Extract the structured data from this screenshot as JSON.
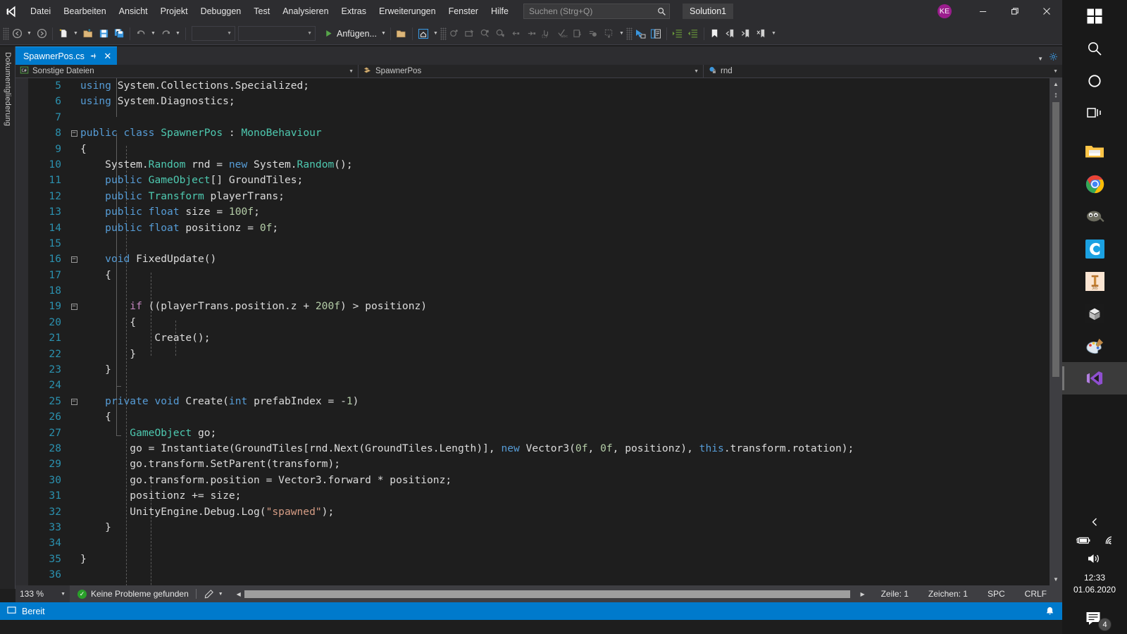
{
  "app": {
    "title": "Visual Studio",
    "solution": "Solution1",
    "user_initials": "KE"
  },
  "menu": {
    "items": [
      "Datei",
      "Bearbeiten",
      "Ansicht",
      "Projekt",
      "Debuggen",
      "Test",
      "Analysieren",
      "Extras",
      "Erweiterungen",
      "Fenster",
      "Hilfe"
    ]
  },
  "search": {
    "placeholder": "Suchen (Strg+Q)",
    "value": "",
    "icon": "search-icon"
  },
  "window_controls": {
    "minimize": "—",
    "restore": "❐",
    "close": "✕"
  },
  "toolbar": {
    "navigate_back": "navigate-back-icon",
    "navigate_forward": "navigate-forward-icon",
    "new_item": "new-item-icon",
    "open_file": "open-file-icon",
    "save": "save-icon",
    "save_all": "save-all-icon",
    "undo": "undo-icon",
    "redo": "redo-icon",
    "config_combo": "",
    "platform_combo": "",
    "run_label": "Anfügen...",
    "run_icon": "play-icon"
  },
  "outline_panel": {
    "label": "Dokumentgliederung"
  },
  "tab": {
    "filename": "SpawnerPos.cs",
    "pin_icon": "pin-icon",
    "close_icon": "close-icon"
  },
  "navbar": {
    "project": "Sonstige Dateien",
    "project_icon": "csharp-file-icon",
    "type": "SpawnerPos",
    "type_icon": "class-icon",
    "member": "rnd",
    "member_icon": "field-private-icon"
  },
  "editor": {
    "first_line": 5,
    "lines": [
      {
        "n": 5,
        "fold": "",
        "tokens": [
          [
            "kw",
            "using"
          ],
          [
            "id",
            " System.Collections.Specialized;"
          ]
        ],
        "indent": 0
      },
      {
        "n": 6,
        "fold": "",
        "tokens": [
          [
            "kw",
            "using"
          ],
          [
            "id",
            " System.Diagnostics;"
          ]
        ],
        "indent": 0
      },
      {
        "n": 7,
        "fold": "",
        "tokens": [],
        "indent": 0
      },
      {
        "n": 8,
        "fold": "-",
        "tokens": [
          [
            "kw",
            "public"
          ],
          [
            "id",
            " "
          ],
          [
            "kw",
            "class"
          ],
          [
            "id",
            " "
          ],
          [
            "typ",
            "SpawnerPos"
          ],
          [
            "id",
            " : "
          ],
          [
            "typ",
            "MonoBehaviour"
          ]
        ],
        "indent": 0
      },
      {
        "n": 9,
        "fold": "",
        "tokens": [
          [
            "id",
            "{"
          ]
        ],
        "indent": 0
      },
      {
        "n": 10,
        "fold": "",
        "tokens": [
          [
            "id",
            "    System."
          ],
          [
            "typ",
            "Random"
          ],
          [
            "id",
            " rnd = "
          ],
          [
            "kw",
            "new"
          ],
          [
            "id",
            " System."
          ],
          [
            "typ",
            "Random"
          ],
          [
            "id",
            "();"
          ]
        ],
        "indent": 0
      },
      {
        "n": 11,
        "fold": "",
        "tokens": [
          [
            "id",
            "    "
          ],
          [
            "kw",
            "public"
          ],
          [
            "id",
            " "
          ],
          [
            "typ",
            "GameObject"
          ],
          [
            "id",
            "[] GroundTiles;"
          ]
        ],
        "indent": 0
      },
      {
        "n": 12,
        "fold": "",
        "tokens": [
          [
            "id",
            "    "
          ],
          [
            "kw",
            "public"
          ],
          [
            "id",
            " "
          ],
          [
            "typ",
            "Transform"
          ],
          [
            "id",
            " playerTrans;"
          ]
        ],
        "indent": 0
      },
      {
        "n": 13,
        "fold": "",
        "tokens": [
          [
            "id",
            "    "
          ],
          [
            "kw",
            "public"
          ],
          [
            "id",
            " "
          ],
          [
            "kw",
            "float"
          ],
          [
            "id",
            " size = "
          ],
          [
            "num",
            "100f"
          ],
          [
            "id",
            ";"
          ]
        ],
        "indent": 0
      },
      {
        "n": 14,
        "fold": "",
        "tokens": [
          [
            "id",
            "    "
          ],
          [
            "kw",
            "public"
          ],
          [
            "id",
            " "
          ],
          [
            "kw",
            "float"
          ],
          [
            "id",
            " positionz = "
          ],
          [
            "num",
            "0f"
          ],
          [
            "id",
            ";"
          ]
        ],
        "indent": 0
      },
      {
        "n": 15,
        "fold": "",
        "tokens": [],
        "indent": 0
      },
      {
        "n": 16,
        "fold": "-",
        "tokens": [
          [
            "id",
            "    "
          ],
          [
            "kw",
            "void"
          ],
          [
            "id",
            " FixedUpdate()"
          ]
        ],
        "indent": 0
      },
      {
        "n": 17,
        "fold": "",
        "tokens": [
          [
            "id",
            "    {"
          ]
        ],
        "indent": 0
      },
      {
        "n": 18,
        "fold": "",
        "tokens": [],
        "indent": 0
      },
      {
        "n": 19,
        "fold": "-",
        "tokens": [
          [
            "id",
            "        "
          ],
          [
            "kwp",
            "if"
          ],
          [
            "id",
            " ((playerTrans.position.z + "
          ],
          [
            "num",
            "200f"
          ],
          [
            "id",
            ") > positionz)"
          ]
        ],
        "indent": 0
      },
      {
        "n": 20,
        "fold": "",
        "tokens": [
          [
            "id",
            "        {"
          ]
        ],
        "indent": 0
      },
      {
        "n": 21,
        "fold": "",
        "tokens": [
          [
            "id",
            "            Create();"
          ]
        ],
        "indent": 0
      },
      {
        "n": 22,
        "fold": "",
        "tokens": [
          [
            "id",
            "        }"
          ]
        ],
        "indent": 0
      },
      {
        "n": 23,
        "fold": "",
        "tokens": [
          [
            "id",
            "    }"
          ]
        ],
        "indent": 0
      },
      {
        "n": 24,
        "fold": "",
        "tokens": [],
        "indent": 0
      },
      {
        "n": 25,
        "fold": "-",
        "tokens": [
          [
            "id",
            "    "
          ],
          [
            "kw",
            "private"
          ],
          [
            "id",
            " "
          ],
          [
            "kw",
            "void"
          ],
          [
            "id",
            " Create("
          ],
          [
            "kw",
            "int"
          ],
          [
            "id",
            " prefabIndex = -"
          ],
          [
            "num",
            "1"
          ],
          [
            "id",
            ")"
          ]
        ],
        "indent": 0
      },
      {
        "n": 26,
        "fold": "",
        "tokens": [
          [
            "id",
            "    {"
          ]
        ],
        "indent": 0
      },
      {
        "n": 27,
        "fold": "",
        "tokens": [
          [
            "id",
            "        "
          ],
          [
            "typ",
            "GameObject"
          ],
          [
            "id",
            " go;"
          ]
        ],
        "indent": 0
      },
      {
        "n": 28,
        "fold": "",
        "tokens": [
          [
            "id",
            "        go = Instantiate(GroundTiles[rnd.Next(GroundTiles.Length)], "
          ],
          [
            "kw",
            "new"
          ],
          [
            "id",
            " Vector3("
          ],
          [
            "num",
            "0f"
          ],
          [
            "id",
            ", "
          ],
          [
            "num",
            "0f"
          ],
          [
            "id",
            ", positionz), "
          ],
          [
            "kw",
            "this"
          ],
          [
            "id",
            ".transform.rotation);"
          ]
        ],
        "indent": 0
      },
      {
        "n": 29,
        "fold": "",
        "tokens": [
          [
            "id",
            "        go.transform.SetParent(transform);"
          ]
        ],
        "indent": 0
      },
      {
        "n": 30,
        "fold": "",
        "tokens": [
          [
            "id",
            "        go.transform.position = Vector3.forward * positionz;"
          ]
        ],
        "indent": 0
      },
      {
        "n": 31,
        "fold": "",
        "tokens": [
          [
            "id",
            "        positionz += size;"
          ]
        ],
        "indent": 0
      },
      {
        "n": 32,
        "fold": "",
        "tokens": [
          [
            "id",
            "        UnityEngine.Debug.Log("
          ],
          [
            "str",
            "\"spawned\""
          ],
          [
            "id",
            ");"
          ]
        ],
        "indent": 0
      },
      {
        "n": 33,
        "fold": "",
        "tokens": [
          [
            "id",
            "    }"
          ]
        ],
        "indent": 0
      },
      {
        "n": 34,
        "fold": "",
        "tokens": [],
        "indent": 0
      },
      {
        "n": 35,
        "fold": "",
        "tokens": [
          [
            "id",
            "}"
          ]
        ],
        "indent": 0
      },
      {
        "n": 36,
        "fold": "",
        "tokens": [],
        "indent": 0
      }
    ]
  },
  "editor_status": {
    "zoom": "133 %",
    "problems": "Keine Probleme gefunden",
    "problems_icon": "check-circle-icon",
    "brush_icon": "pen-icon",
    "line_label": "Zeile: 1",
    "char_label": "Zeichen: 1",
    "insert_mode": "SPC",
    "line_endings": "CRLF"
  },
  "status_bar": {
    "text": "Bereit",
    "icon": "square-icon",
    "bell_icon": "bell-icon"
  },
  "taskbar": {
    "items": [
      {
        "name": "start-button",
        "icon": "windows-logo-icon"
      },
      {
        "name": "search-button",
        "icon": "search-icon"
      },
      {
        "name": "cortana-button",
        "icon": "circle-icon"
      },
      {
        "name": "task-view-button",
        "icon": "task-view-icon"
      },
      {
        "name": "file-explorer",
        "icon": "folder-icon"
      },
      {
        "name": "google-chrome",
        "icon": "chrome-icon"
      },
      {
        "name": "gimp",
        "icon": "gimp-icon"
      },
      {
        "name": "cinema4d",
        "icon": "c-icon"
      },
      {
        "name": "blender-or-tool",
        "icon": "tool-icon"
      },
      {
        "name": "unity",
        "icon": "unity-icon"
      },
      {
        "name": "paint",
        "icon": "paint-icon"
      },
      {
        "name": "visual-studio",
        "icon": "visual-studio-icon"
      }
    ],
    "tray": {
      "expand_icon": "chevron-up-icon",
      "battery_icon": "battery-charging-icon",
      "wifi_icon": "wifi-icon",
      "volume_icon": "speaker-icon",
      "time": "12:33",
      "date": "01.06.2020",
      "notification_icon": "action-center-icon",
      "notification_count": "4"
    }
  },
  "colors": {
    "accent": "#007acc",
    "chrome": "#2d2d30",
    "editor_bg": "#1e1e1e",
    "line_number": "#2b91af",
    "keyword": "#569cd6",
    "type": "#4ec9b0",
    "control": "#c586c0",
    "string": "#d69d85",
    "number": "#b5cea8"
  }
}
